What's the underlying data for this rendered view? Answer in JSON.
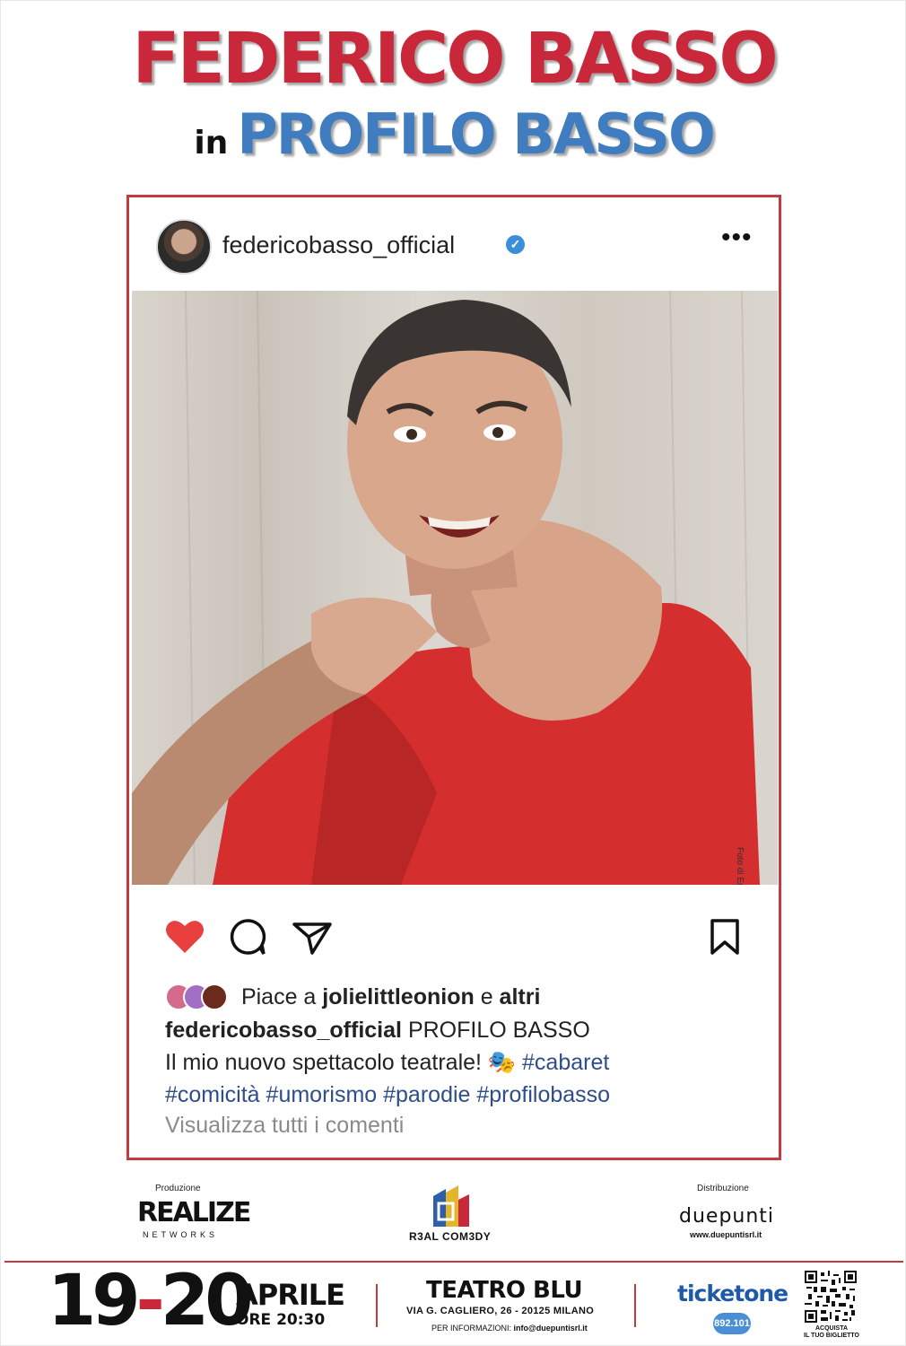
{
  "title": {
    "performer": "FEDERICO BASSO",
    "connector": "in",
    "show": "PROFILO BASSO"
  },
  "post": {
    "username": "federicobasso_official",
    "verified_mark": "✓",
    "more_icon": "•••",
    "photo_credit": "Foto di Eracrea Art",
    "likes_prefix": "Piace a",
    "likes_user": "jolielittleonion",
    "likes_joiner": "e",
    "likes_suffix": "altri",
    "caption_user": "federicobasso_official",
    "caption_title": "PROFILO BASSO",
    "caption_text": "Il mio nuovo spettacolo teatrale! 🎭",
    "hashtags_line1": "#cabaret",
    "hashtags_line2": "#comicità #umorismo #parodie #profilobasso",
    "comments_link": "Visualizza tutti i comenti",
    "icons": [
      "heart-icon",
      "comment-icon",
      "share-icon",
      "bookmark-icon"
    ],
    "colors": {
      "heart": "#e8403f",
      "frame": "#c53a3f",
      "hashtag": "#2e4d8a"
    }
  },
  "sponsors": {
    "production_label": "Produzione",
    "production_name": "REALIZE",
    "production_sub": "NETWORKS",
    "center_name": "R3AL COM3DY",
    "distribution_label": "Distribuzione",
    "distribution_name": "duepunti",
    "distribution_url": "www.duepuntisrl.it"
  },
  "event": {
    "day_start": "19",
    "dash": "-",
    "day_end": "20",
    "month": "APRILE",
    "time": "ORE 20:30",
    "venue": "TEATRO BLU",
    "address": "VIA G. CAGLIERO, 26 - 20125 MILANO",
    "info_label": "PER INFORMAZIONI:",
    "info_email": "info@duepuntisrl.it",
    "ticket_brand": "ticketone",
    "ticket_number": "892.101",
    "qr_label_1": "ACQUISTA",
    "qr_label_2": "IL TUO BIGLIETTO"
  }
}
